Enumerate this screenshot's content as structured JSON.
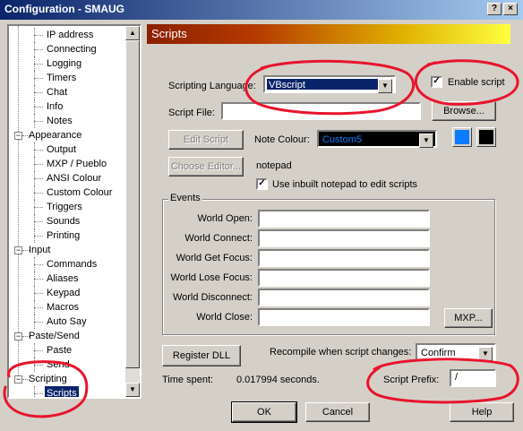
{
  "window": {
    "title": "Configuration - SMAUG",
    "minimize": "?",
    "close": "×"
  },
  "tree": {
    "items": [
      {
        "label": "IP address",
        "level": 1
      },
      {
        "label": "Connecting",
        "level": 1
      },
      {
        "label": "Logging",
        "level": 1
      },
      {
        "label": "Timers",
        "level": 1
      },
      {
        "label": "Chat",
        "level": 1
      },
      {
        "label": "Info",
        "level": 1
      },
      {
        "label": "Notes",
        "level": 1
      },
      {
        "label": "Appearance",
        "level": 0,
        "expanded": true
      },
      {
        "label": "Output",
        "level": 1
      },
      {
        "label": "MXP / Pueblo",
        "level": 1
      },
      {
        "label": "ANSI Colour",
        "level": 1
      },
      {
        "label": "Custom Colour",
        "level": 1
      },
      {
        "label": "Triggers",
        "level": 1
      },
      {
        "label": "Sounds",
        "level": 1
      },
      {
        "label": "Printing",
        "level": 1
      },
      {
        "label": "Input",
        "level": 0,
        "expanded": true
      },
      {
        "label": "Commands",
        "level": 1
      },
      {
        "label": "Aliases",
        "level": 1
      },
      {
        "label": "Keypad",
        "level": 1
      },
      {
        "label": "Macros",
        "level": 1
      },
      {
        "label": "Auto Say",
        "level": 1
      },
      {
        "label": "Paste/Send",
        "level": 0,
        "expanded": true
      },
      {
        "label": "Paste",
        "level": 1
      },
      {
        "label": "Send",
        "level": 1
      },
      {
        "label": "Scripting",
        "level": 0,
        "expanded": true
      },
      {
        "label": "Scripts",
        "level": 1,
        "selected": true
      }
    ]
  },
  "header": {
    "title": "Scripts"
  },
  "scripting": {
    "language_label": "Scripting Language:",
    "language_value": "VBscript",
    "enable_label": "Enable script",
    "enable_checked": true,
    "file_label": "Script File:",
    "file_value": "",
    "browse_label": "Browse...",
    "edit_script_label": "Edit Script",
    "note_colour_label": "Note Colour:",
    "note_colour_value": "Custom5",
    "choose_editor_label": "Choose Editor...",
    "editor_name": "notepad",
    "use_inbuilt_label": "Use inbuilt notepad to edit scripts",
    "use_inbuilt_checked": true,
    "swatch_fg": "#0a7bff",
    "swatch_bg": "#000000"
  },
  "events": {
    "title": "Events",
    "fields": [
      {
        "label": "World Open:",
        "value": ""
      },
      {
        "label": "World Connect:",
        "value": ""
      },
      {
        "label": "World Get Focus:",
        "value": ""
      },
      {
        "label": "World Lose Focus:",
        "value": ""
      },
      {
        "label": "World Disconnect:",
        "value": ""
      },
      {
        "label": "World Close:",
        "value": ""
      }
    ],
    "mxp_label": "MXP..."
  },
  "bottom": {
    "register_dll_label": "Register DLL",
    "recompile_label": "Recompile when script changes:",
    "recompile_value": "Confirm",
    "time_spent_label": "Time spent:",
    "time_spent_value": "0.017994 seconds.",
    "prefix_label": "Script Prefix:",
    "prefix_value": "/"
  },
  "dialog_buttons": {
    "ok": "OK",
    "cancel": "Cancel",
    "help": "Help"
  },
  "colors": {
    "annotation": "#e8142c",
    "titlebar": "#0a246a",
    "selection": "#0a246a"
  }
}
